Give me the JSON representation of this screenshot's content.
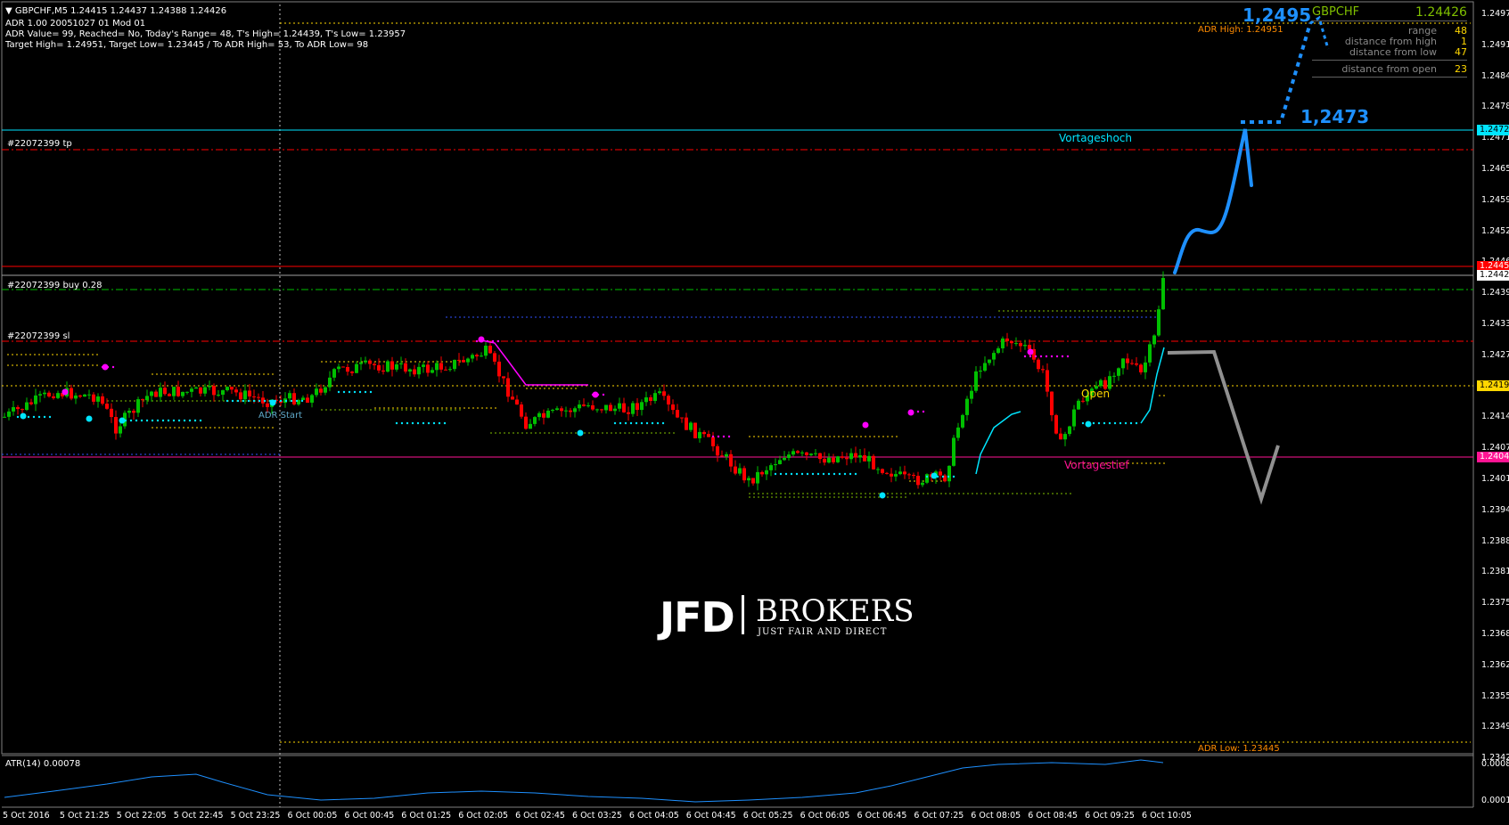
{
  "header": {
    "symbol_line": "GBPCHF,M5  1.24415 1.24437 1.24388 1.24426",
    "adr_line": "ADR 1.00 20051027 01 Mod 01",
    "adr_value_line": "ADR Value= 99, Reached= No, Today's Range= 48, T's High= 1.24439, T's Low= 1.23957",
    "target_line": "Target High= 1.24951, Target Low= 1.23445 / To ADR High= 53, To ADR Low= 98"
  },
  "panel": {
    "symbol": "GBPCHF",
    "bid": "1.24426",
    "rows": [
      {
        "key": "range",
        "value": "48"
      },
      {
        "key": "distance from high",
        "value": "1"
      },
      {
        "key": "distance from low",
        "value": "47"
      },
      {
        "key": "distance from open",
        "value": "23"
      }
    ]
  },
  "annotations": {
    "target_high": "1,2495",
    "target_mid": "1,2473",
    "vortageshoch": "Vortageshoch",
    "vortagestief": "Vortagestief",
    "open": "Open",
    "adr_start": "ADR Start",
    "adr_high": "ADR High: 1.24951",
    "adr_low": "ADR Low: 1.23445"
  },
  "orders": {
    "tp": "#22072399 tp",
    "buy": "#22072399 buy 0.28",
    "sl": "#22072399 sl"
  },
  "price_axis": [
    "1.24975",
    "1.24910",
    "1.24845",
    "1.24780",
    "1.24715",
    "1.24655",
    "1.24590",
    "1.24525",
    "1.24460",
    "1.24395",
    "1.24335",
    "1.24270",
    "1.24205",
    "1.24140",
    "1.24075",
    "1.24010",
    "1.23945",
    "1.23880",
    "1.23815",
    "1.23750",
    "1.23685",
    "1.23620",
    "1.23555",
    "1.23490",
    "1.23425"
  ],
  "price_badges": {
    "vortageshoch": "1.24727",
    "current": "1.24426",
    "open": "1.24192",
    "vortagestief": "1.24043",
    "red_line": "1.24455"
  },
  "time_axis": [
    "5 Oct 2016",
    "5 Oct 21:25",
    "5 Oct 22:05",
    "5 Oct 22:45",
    "5 Oct 23:25",
    "6 Oct 00:05",
    "6 Oct 00:45",
    "6 Oct 01:25",
    "6 Oct 02:05",
    "6 Oct 02:45",
    "6 Oct 03:25",
    "6 Oct 04:05",
    "6 Oct 04:45",
    "6 Oct 05:25",
    "6 Oct 06:05",
    "6 Oct 06:45",
    "6 Oct 07:25",
    "6 Oct 08:05",
    "6 Oct 08:45",
    "6 Oct 09:25",
    "6 Oct 10:05"
  ],
  "atr": {
    "label": "ATR(14) 0.00078",
    "axis_top": "0.00084",
    "axis_bottom": "0.00018"
  },
  "watermark": {
    "brand": "JFD",
    "brand2": "BROKERS",
    "tagline": "JUST FAIR AND DIRECT"
  },
  "colors": {
    "bull": "#00c000",
    "bear": "#ff0000",
    "forecast_up": "#1e90ff",
    "forecast_down": "#909090",
    "vortageshoch": "#00e5ff",
    "vortagestief": "#ff1493",
    "open_line": "#ffd700"
  }
}
